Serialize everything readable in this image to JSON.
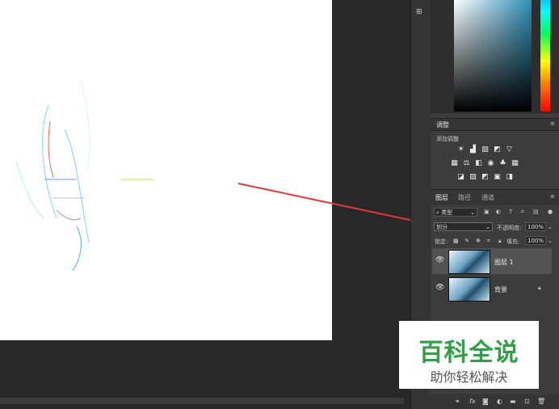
{
  "adjust_panel": {
    "title": "调整",
    "add_label": "添加调整"
  },
  "layers_panel": {
    "tabs": [
      "图层",
      "路径",
      "通道"
    ],
    "filter_kind": "类型",
    "blend_mode": "划分",
    "opacity_label": "不透明度:",
    "opacity_value": "100%",
    "lock_label": "锁定:",
    "fill_label": "填充:",
    "fill_value": "100%",
    "layers": [
      {
        "name": "图层 1",
        "selected": true
      },
      {
        "name": "背景",
        "locked": true
      }
    ]
  },
  "watermark": {
    "title": "百科全说",
    "subtitle": "助你轻松解决"
  },
  "colors": {
    "arrow": "#e03a3a",
    "brand_green": "#2fa043",
    "panel_bg": "#3c3c3c"
  }
}
